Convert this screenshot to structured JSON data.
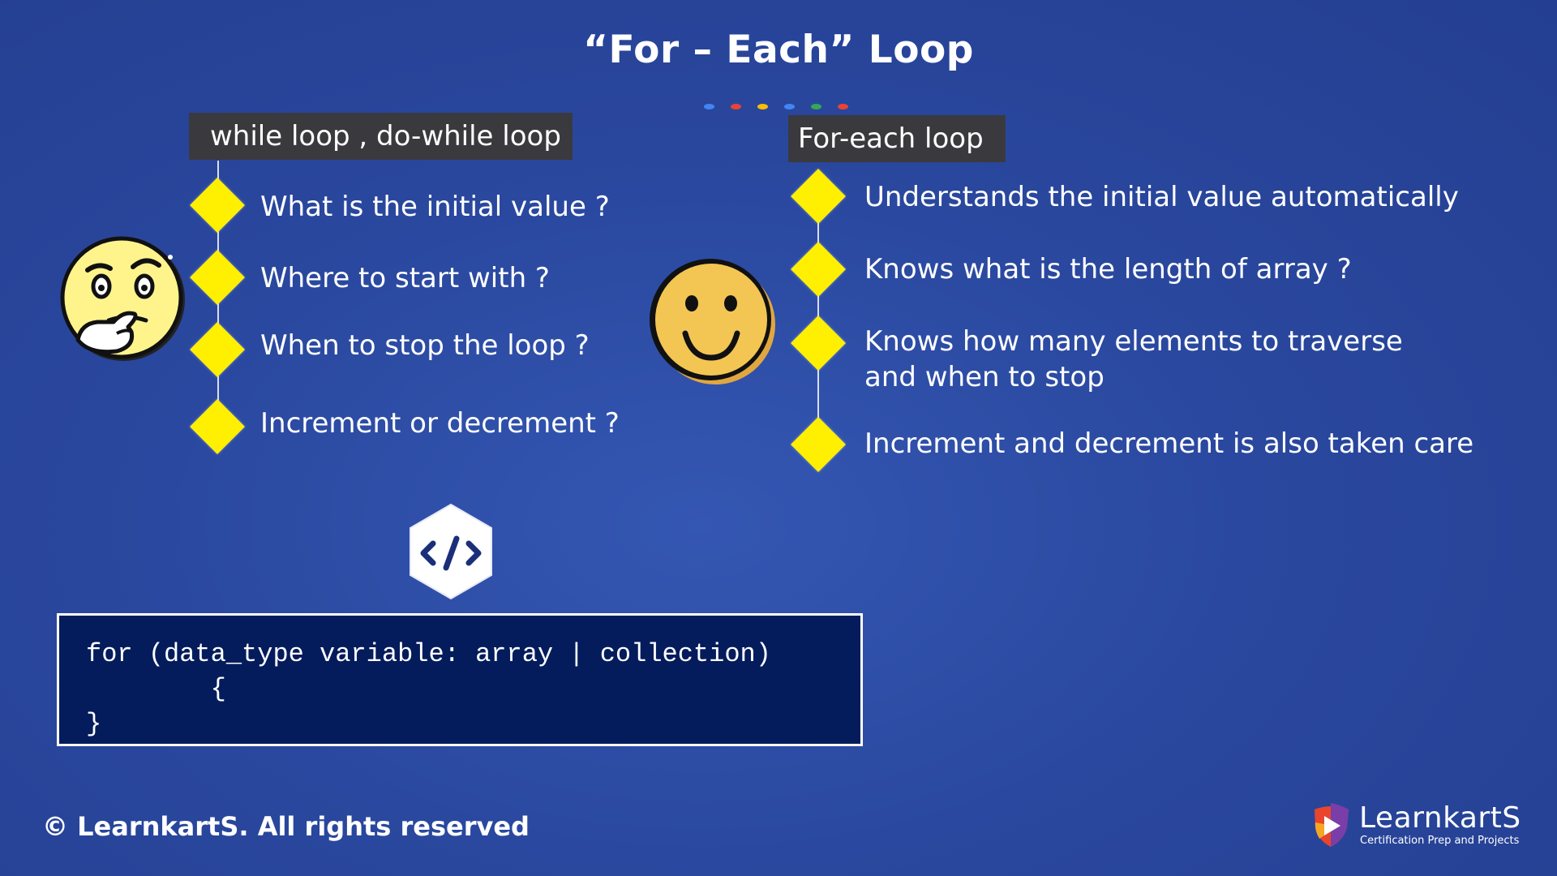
{
  "title": "“For – Each” Loop",
  "dot_colors": [
    "#4285f4",
    "#ea4335",
    "#fbbc05",
    "#4285f4",
    "#34a853",
    "#ea4335"
  ],
  "left_panel": {
    "header": "while loop , do-while loop",
    "items": [
      "What is the initial value ?",
      "Where to start with ?",
      "When to stop the  loop ?",
      "Increment or decrement ?"
    ],
    "emoji": "thinking-face"
  },
  "right_panel": {
    "header": "For-each loop",
    "items": [
      "Understands the initial value automatically",
      "Knows what is the length of array ?",
      "Knows how many elements to traverse",
      "and when to stop",
      "Increment and decrement  is also taken care"
    ],
    "emoji": "smiling-face"
  },
  "code": {
    "icon": "code-icon",
    "lines": [
      "for (data_type variable: array | collection)",
      "        {",
      "}"
    ]
  },
  "footer": {
    "copyright": "© LearnkartS. All rights reserved",
    "logo_name": "LearnkartS",
    "logo_tagline": "Certification Prep and Projects"
  },
  "colors": {
    "background": "#2a489f",
    "diamond": "#ffef00",
    "header_box": "#3a3a3e",
    "code_box": "#041c5c"
  }
}
